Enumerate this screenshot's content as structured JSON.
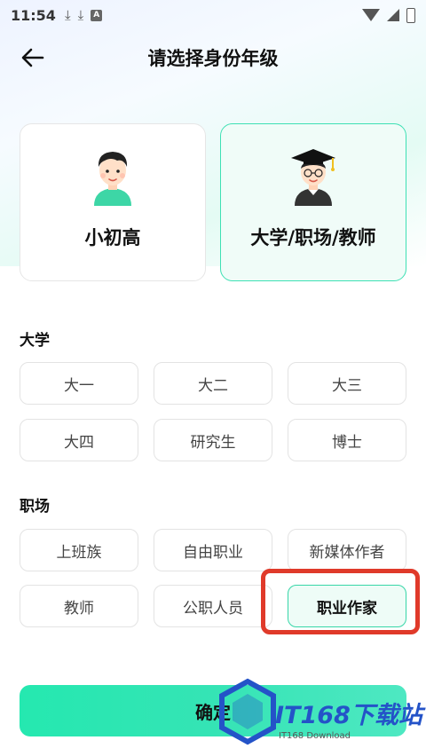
{
  "status_bar": {
    "time": "11:54",
    "icons": [
      "download-icon",
      "download-icon",
      "a-app-icon",
      "wifi-icon",
      "signal-icon",
      "battery-icon"
    ]
  },
  "header": {
    "title": "请选择身份年级",
    "back_icon": "arrow-left-icon"
  },
  "identity_cards": [
    {
      "label": "小初高",
      "selected": false
    },
    {
      "label": "大学/职场/教师",
      "selected": true
    }
  ],
  "sections": [
    {
      "title": "大学",
      "options": [
        "大一",
        "大二",
        "大三",
        "大四",
        "研究生",
        "博士"
      ]
    },
    {
      "title": "职场",
      "options": [
        "上班族",
        "自由职业",
        "新媒体作者",
        "教师",
        "公职人员",
        "职业作家"
      ],
      "selected": "职业作家"
    }
  ],
  "confirm_button": {
    "label": "确定"
  },
  "watermark": {
    "text": "IT168下载站",
    "sub": "IT168 Download"
  },
  "colors": {
    "accent": "#37d6a8",
    "highlight": "#e03a2a",
    "watermark": "#2453c8"
  }
}
